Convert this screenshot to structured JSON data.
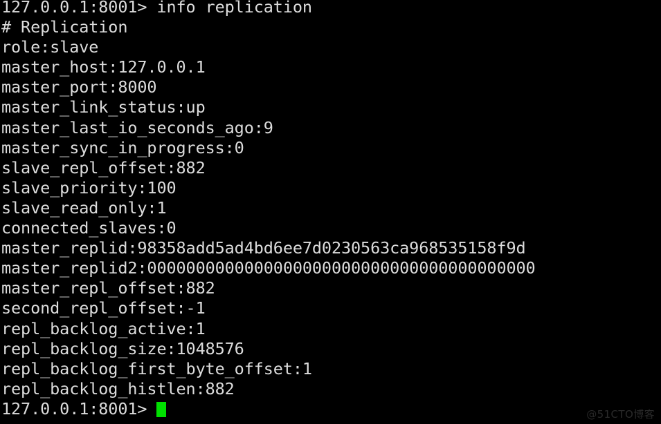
{
  "terminal": {
    "background_color": "#000000",
    "text_color": "#dcdcdc",
    "cursor_color": "#00e000",
    "prompt": "127.0.0.1:8001>",
    "command": "info replication",
    "section_header": "# Replication",
    "lines": [
      "127.0.0.1:8001> info replication",
      "# Replication",
      "role:slave",
      "master_host:127.0.0.1",
      "master_port:8000",
      "master_link_status:up",
      "master_last_io_seconds_ago:9",
      "master_sync_in_progress:0",
      "slave_repl_offset:882",
      "slave_priority:100",
      "slave_read_only:1",
      "connected_slaves:0",
      "master_replid:98358add5ad4bd6ee7d0230563ca968535158f9d",
      "master_replid2:0000000000000000000000000000000000000000",
      "master_repl_offset:882",
      "second_repl_offset:-1",
      "repl_backlog_active:1",
      "repl_backlog_size:1048576",
      "repl_backlog_first_byte_offset:1",
      "repl_backlog_histlen:882"
    ],
    "final_prompt": "127.0.0.1:8001> ",
    "fields": {
      "role": "slave",
      "master_host": "127.0.0.1",
      "master_port": "8000",
      "master_link_status": "up",
      "master_last_io_seconds_ago": "9",
      "master_sync_in_progress": "0",
      "slave_repl_offset": "882",
      "slave_priority": "100",
      "slave_read_only": "1",
      "connected_slaves": "0",
      "master_replid": "98358add5ad4bd6ee7d0230563ca968535158f9d",
      "master_replid2": "0000000000000000000000000000000000000000",
      "master_repl_offset": "882",
      "second_repl_offset": "-1",
      "repl_backlog_active": "1",
      "repl_backlog_size": "1048576",
      "repl_backlog_first_byte_offset": "1",
      "repl_backlog_histlen": "882"
    }
  },
  "watermark": {
    "text": "@51CTO博客"
  }
}
